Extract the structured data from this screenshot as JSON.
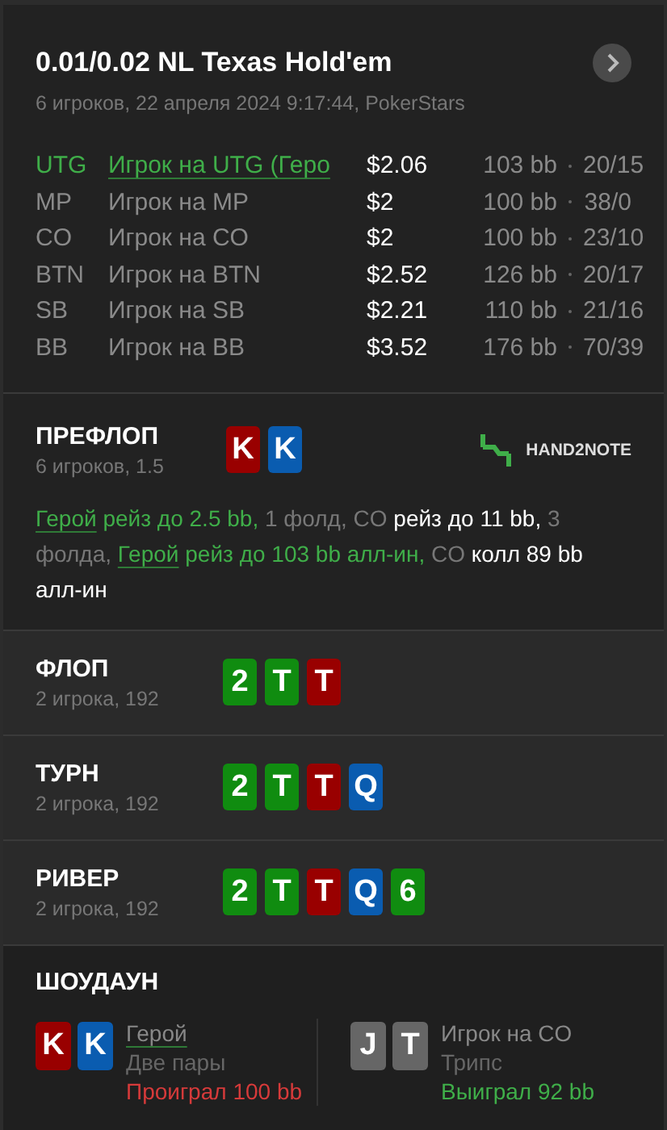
{
  "header": {
    "title": "0.01/0.02 NL Texas Hold'em",
    "subtitle": "6 игроков, 22 апреля 2024 9:17:44, PokerStars"
  },
  "players": [
    {
      "position": "UTG",
      "name": "Игрок на UTG (Геро",
      "stack": "$2.06",
      "bb": "103 bb",
      "stats": "20/15",
      "hero": true
    },
    {
      "position": "MP",
      "name": "Игрок на MP",
      "stack": "$2",
      "bb": "100 bb",
      "stats": "38/0",
      "hero": false
    },
    {
      "position": "CO",
      "name": "Игрок на CO",
      "stack": "$2",
      "bb": "100 bb",
      "stats": "23/10",
      "hero": false
    },
    {
      "position": "BTN",
      "name": "Игрок на BTN",
      "stack": "$2.52",
      "bb": "126 bb",
      "stats": "20/17",
      "hero": false
    },
    {
      "position": "SB",
      "name": "Игрок на SB",
      "stack": "$2.21",
      "bb": "110 bb",
      "stats": "21/16",
      "hero": false
    },
    {
      "position": "BB",
      "name": "Игрок на BB",
      "stack": "$3.52",
      "bb": "176 bb",
      "stats": "70/39",
      "hero": false
    }
  ],
  "preflop": {
    "title": "ПРЕФЛОП",
    "subtitle": "6 игроков, 1.5",
    "cards": [
      {
        "rank": "K",
        "color": "#990000"
      },
      {
        "rank": "K",
        "color": "#0a5cb0"
      }
    ],
    "logo": "HAND2NOTE",
    "actions": [
      {
        "kind": "hero-link",
        "text": "Герой"
      },
      {
        "kind": "hero",
        "text": " рейз до 2.5 bb,"
      },
      {
        "kind": "muted",
        "text": " 1 фолд, CO"
      },
      {
        "kind": "bright",
        "text": " рейз до 11 bb,"
      },
      {
        "kind": "muted",
        "text": " 3 фолда, "
      },
      {
        "kind": "hero-link",
        "text": "Герой"
      },
      {
        "kind": "hero",
        "text": " рейз до 103 bb алл-ин,"
      },
      {
        "kind": "muted",
        "text": " CO"
      },
      {
        "kind": "bright",
        "text": " колл 89 bb алл-ин"
      }
    ]
  },
  "streets": [
    {
      "title": "ФЛОП",
      "subtitle": "2 игрока, 192",
      "cards": [
        {
          "rank": "2",
          "color": "#108c10"
        },
        {
          "rank": "T",
          "color": "#108c10"
        },
        {
          "rank": "T",
          "color": "#990000"
        }
      ]
    },
    {
      "title": "ТУРН",
      "subtitle": "2 игрока, 192",
      "cards": [
        {
          "rank": "2",
          "color": "#108c10"
        },
        {
          "rank": "T",
          "color": "#108c10"
        },
        {
          "rank": "T",
          "color": "#990000"
        },
        {
          "rank": "Q",
          "color": "#0a5cb0"
        }
      ]
    },
    {
      "title": "РИВЕР",
      "subtitle": "2 игрока, 192",
      "cards": [
        {
          "rank": "2",
          "color": "#108c10"
        },
        {
          "rank": "T",
          "color": "#108c10"
        },
        {
          "rank": "T",
          "color": "#990000"
        },
        {
          "rank": "Q",
          "color": "#0a5cb0"
        },
        {
          "rank": "6",
          "color": "#108c10"
        }
      ]
    }
  ],
  "showdown": {
    "title": "ШОУДАУН",
    "hands": [
      {
        "name": "Герой",
        "hero": true,
        "hand": "Две пары",
        "result": "Проиграл 100 bb",
        "won": false,
        "cards": [
          {
            "rank": "K",
            "color": "#990000"
          },
          {
            "rank": "K",
            "color": "#0a5cb0"
          }
        ]
      },
      {
        "name": "Игрок на CO",
        "hero": false,
        "hand": "Трипс",
        "result": "Выиграл 92 bb",
        "won": true,
        "cards": [
          {
            "rank": "J",
            "color": "#666666"
          },
          {
            "rank": "T",
            "color": "#666666"
          }
        ]
      }
    ]
  }
}
